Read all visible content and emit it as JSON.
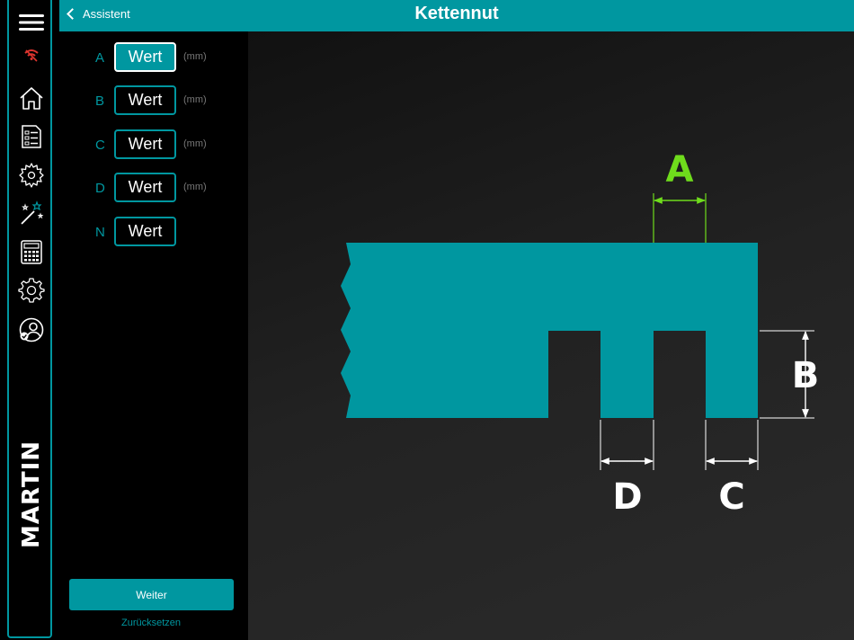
{
  "header": {
    "title": "Kettennut",
    "back_label": "Assistent"
  },
  "fields": [
    {
      "label": "A",
      "value": "Wert",
      "unit": "(mm)"
    },
    {
      "label": "B",
      "value": "Wert",
      "unit": "(mm)"
    },
    {
      "label": "C",
      "value": "Wert",
      "unit": "(mm)"
    },
    {
      "label": "D",
      "value": "Wert",
      "unit": "(mm)"
    },
    {
      "label": "N",
      "value": "Wert",
      "unit": ""
    }
  ],
  "actions": {
    "next_label": "Weiter",
    "reset_label": "Zurücksetzen"
  },
  "brand": "MARTIN",
  "diagram": {
    "labels": {
      "a": "A",
      "b": "B",
      "c": "C",
      "d": "D"
    }
  },
  "colors": {
    "accent": "#0097a0",
    "highlight": "#6fdc1c",
    "warning": "#e0352f"
  },
  "sidebar_icons": [
    "menu-icon",
    "wifi-off-icon",
    "home-icon",
    "checklist-icon",
    "saw-blade-icon",
    "magic-wand-icon",
    "calculator-icon",
    "settings-icon",
    "user-icon"
  ]
}
